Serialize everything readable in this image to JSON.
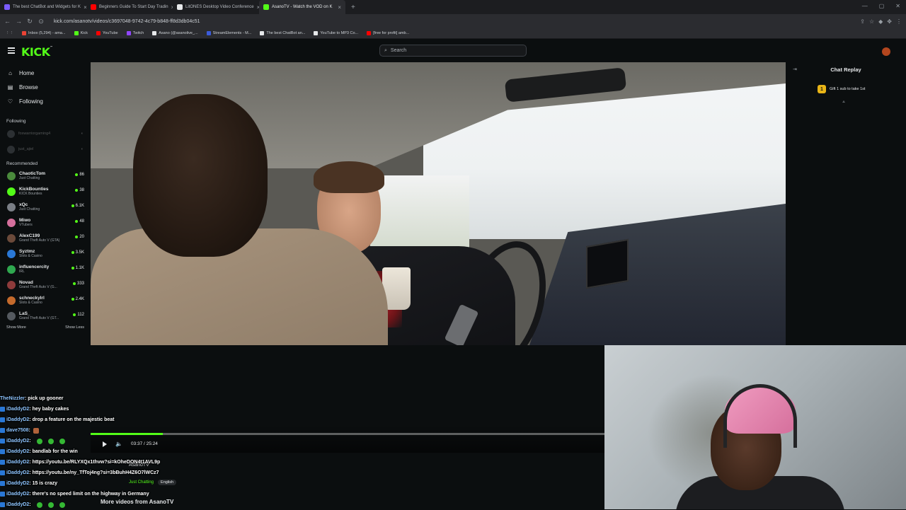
{
  "browser": {
    "tabs": [
      {
        "title": "The best ChatBot and Widgets for K",
        "color": "#7b5cff",
        "active": false
      },
      {
        "title": "Beginners Guide To Start Day Tradin",
        "color": "#ff0000",
        "active": false
      },
      {
        "title": "LitONES Desktop Video Conference",
        "color": "#e6e8ea",
        "active": false
      },
      {
        "title": "AsanoTV - Watch the VOD on K",
        "color": "#53fc18",
        "active": true
      }
    ],
    "url": "kick.com/asanotv/videos/c3697048-9742-4c79-b848-ff8d3db04c51",
    "bookmarks": [
      {
        "label": "Inbox (5,294) - ama...",
        "color": "#ea4335"
      },
      {
        "label": "Kick",
        "color": "#53fc18"
      },
      {
        "label": "YouTube",
        "color": "#ff0000"
      },
      {
        "label": "Twitch",
        "color": "#9146ff"
      },
      {
        "label": "Asano (@asanolive_...",
        "color": "#e6e8ea"
      },
      {
        "label": "StreamElements - M...",
        "color": "#3b5bdb"
      },
      {
        "label": "The best ChatBot an...",
        "color": "#e6e8ea"
      },
      {
        "label": "YouTube to MP3 Co...",
        "color": "#e6e8ea"
      },
      {
        "label": "[free for profit] amb...",
        "color": "#ff0000"
      }
    ]
  },
  "header": {
    "logo": "KICK",
    "search_placeholder": "Search"
  },
  "sidebar": {
    "nav": [
      {
        "label": "Home",
        "icon": "home-icon",
        "glyph": "⌂"
      },
      {
        "label": "Browse",
        "icon": "browse-icon",
        "glyph": "▤"
      },
      {
        "label": "Following",
        "icon": "heart-icon",
        "glyph": "♡"
      }
    ],
    "following_header": "Following",
    "following": [
      {
        "name": "foxwarriorgaming4"
      },
      {
        "name": "just_ajiel"
      }
    ],
    "recommended_header": "Recommended",
    "recommended": [
      {
        "name": "ChaoticTom",
        "category": "Just Chatting",
        "viewers": "86",
        "color": "#4a8a3c"
      },
      {
        "name": "KickBounties",
        "category": "KICK Bounties",
        "viewers": "38",
        "color": "#53fc18"
      },
      {
        "name": "xQc",
        "category": "Just Chatting",
        "viewers": "6.1K",
        "color": "#7a7f86"
      },
      {
        "name": "Miwo",
        "category": "VTubers",
        "viewers": "48",
        "color": "#d56f9c"
      },
      {
        "name": "AlexC199",
        "category": "Grand Theft Auto V (GTA)",
        "viewers": "20",
        "color": "#6b4a3a"
      },
      {
        "name": "Syztmz",
        "category": "Slots & Casino",
        "viewers": "3.5K",
        "color": "#2a78d6"
      },
      {
        "name": "influencercity",
        "category": "IRL",
        "viewers": "1.1K",
        "color": "#2fa84f"
      },
      {
        "name": "Novad",
        "category": "Grand Theft Auto V (G...",
        "viewers": "333",
        "color": "#8e3b3b"
      },
      {
        "name": "schneckyIrl",
        "category": "Slots & Casino",
        "viewers": "2.4K",
        "color": "#c46a2c"
      },
      {
        "name": "LaS_",
        "category": "Grand Theft Auto V (GT...",
        "viewers": "112",
        "color": "#555a60"
      }
    ],
    "show_more": "Show More",
    "show_less": "Show Less"
  },
  "player": {
    "time": "03:37 / 25:24",
    "progress": 0.14
  },
  "chat_replay": {
    "title": "Chat Replay",
    "gift_text": "Gift 1 sub to take 1st"
  },
  "chat_overlay": [
    {
      "user": "TheNizzler",
      "text": ": pick up gooner",
      "badge": false,
      "emotes": 0
    },
    {
      "user": "iDaddyD2",
      "text": ": hey baby cakes",
      "badge": true,
      "emotes": 0
    },
    {
      "user": "iDaddyD2",
      "text": ": drop a feature on the majestic beat",
      "badge": true,
      "emotes": 0
    },
    {
      "user": "dave7508",
      "text": ":",
      "badge": true,
      "emotes": 0,
      "cake": true
    },
    {
      "user": "iDaddyD2",
      "text": ":",
      "badge": true,
      "emotes": 3
    },
    {
      "user": "iDaddyD2",
      "text": ": bandlab for the win",
      "badge": true,
      "emotes": 0
    },
    {
      "user": "iDaddyD2",
      "text": ": https://youtu.be/RLYXQx1thvw?si=kOheDON4t1AVL9p",
      "badge": true,
      "emotes": 0
    },
    {
      "user": "iDaddyD2",
      "text": ": https://youtu.be/ny_TfToj4ng?si=3bBuhH4Z6O7lWCz7",
      "badge": true,
      "emotes": 0
    },
    {
      "user": "iDaddyD2",
      "text": ": 15 is crazy",
      "badge": true,
      "emotes": 0
    },
    {
      "user": "iDaddyD2",
      "text": ": there's no speed limit on the highway in Germany",
      "badge": true,
      "emotes": 0
    },
    {
      "user": "iDaddyD2",
      "text": ":",
      "badge": true,
      "emotes": 3
    }
  ],
  "below_player": {
    "channel": "AsanoTV",
    "category": "Just Chatting",
    "language": "English",
    "more_videos": "More videos from AsanoTV"
  }
}
